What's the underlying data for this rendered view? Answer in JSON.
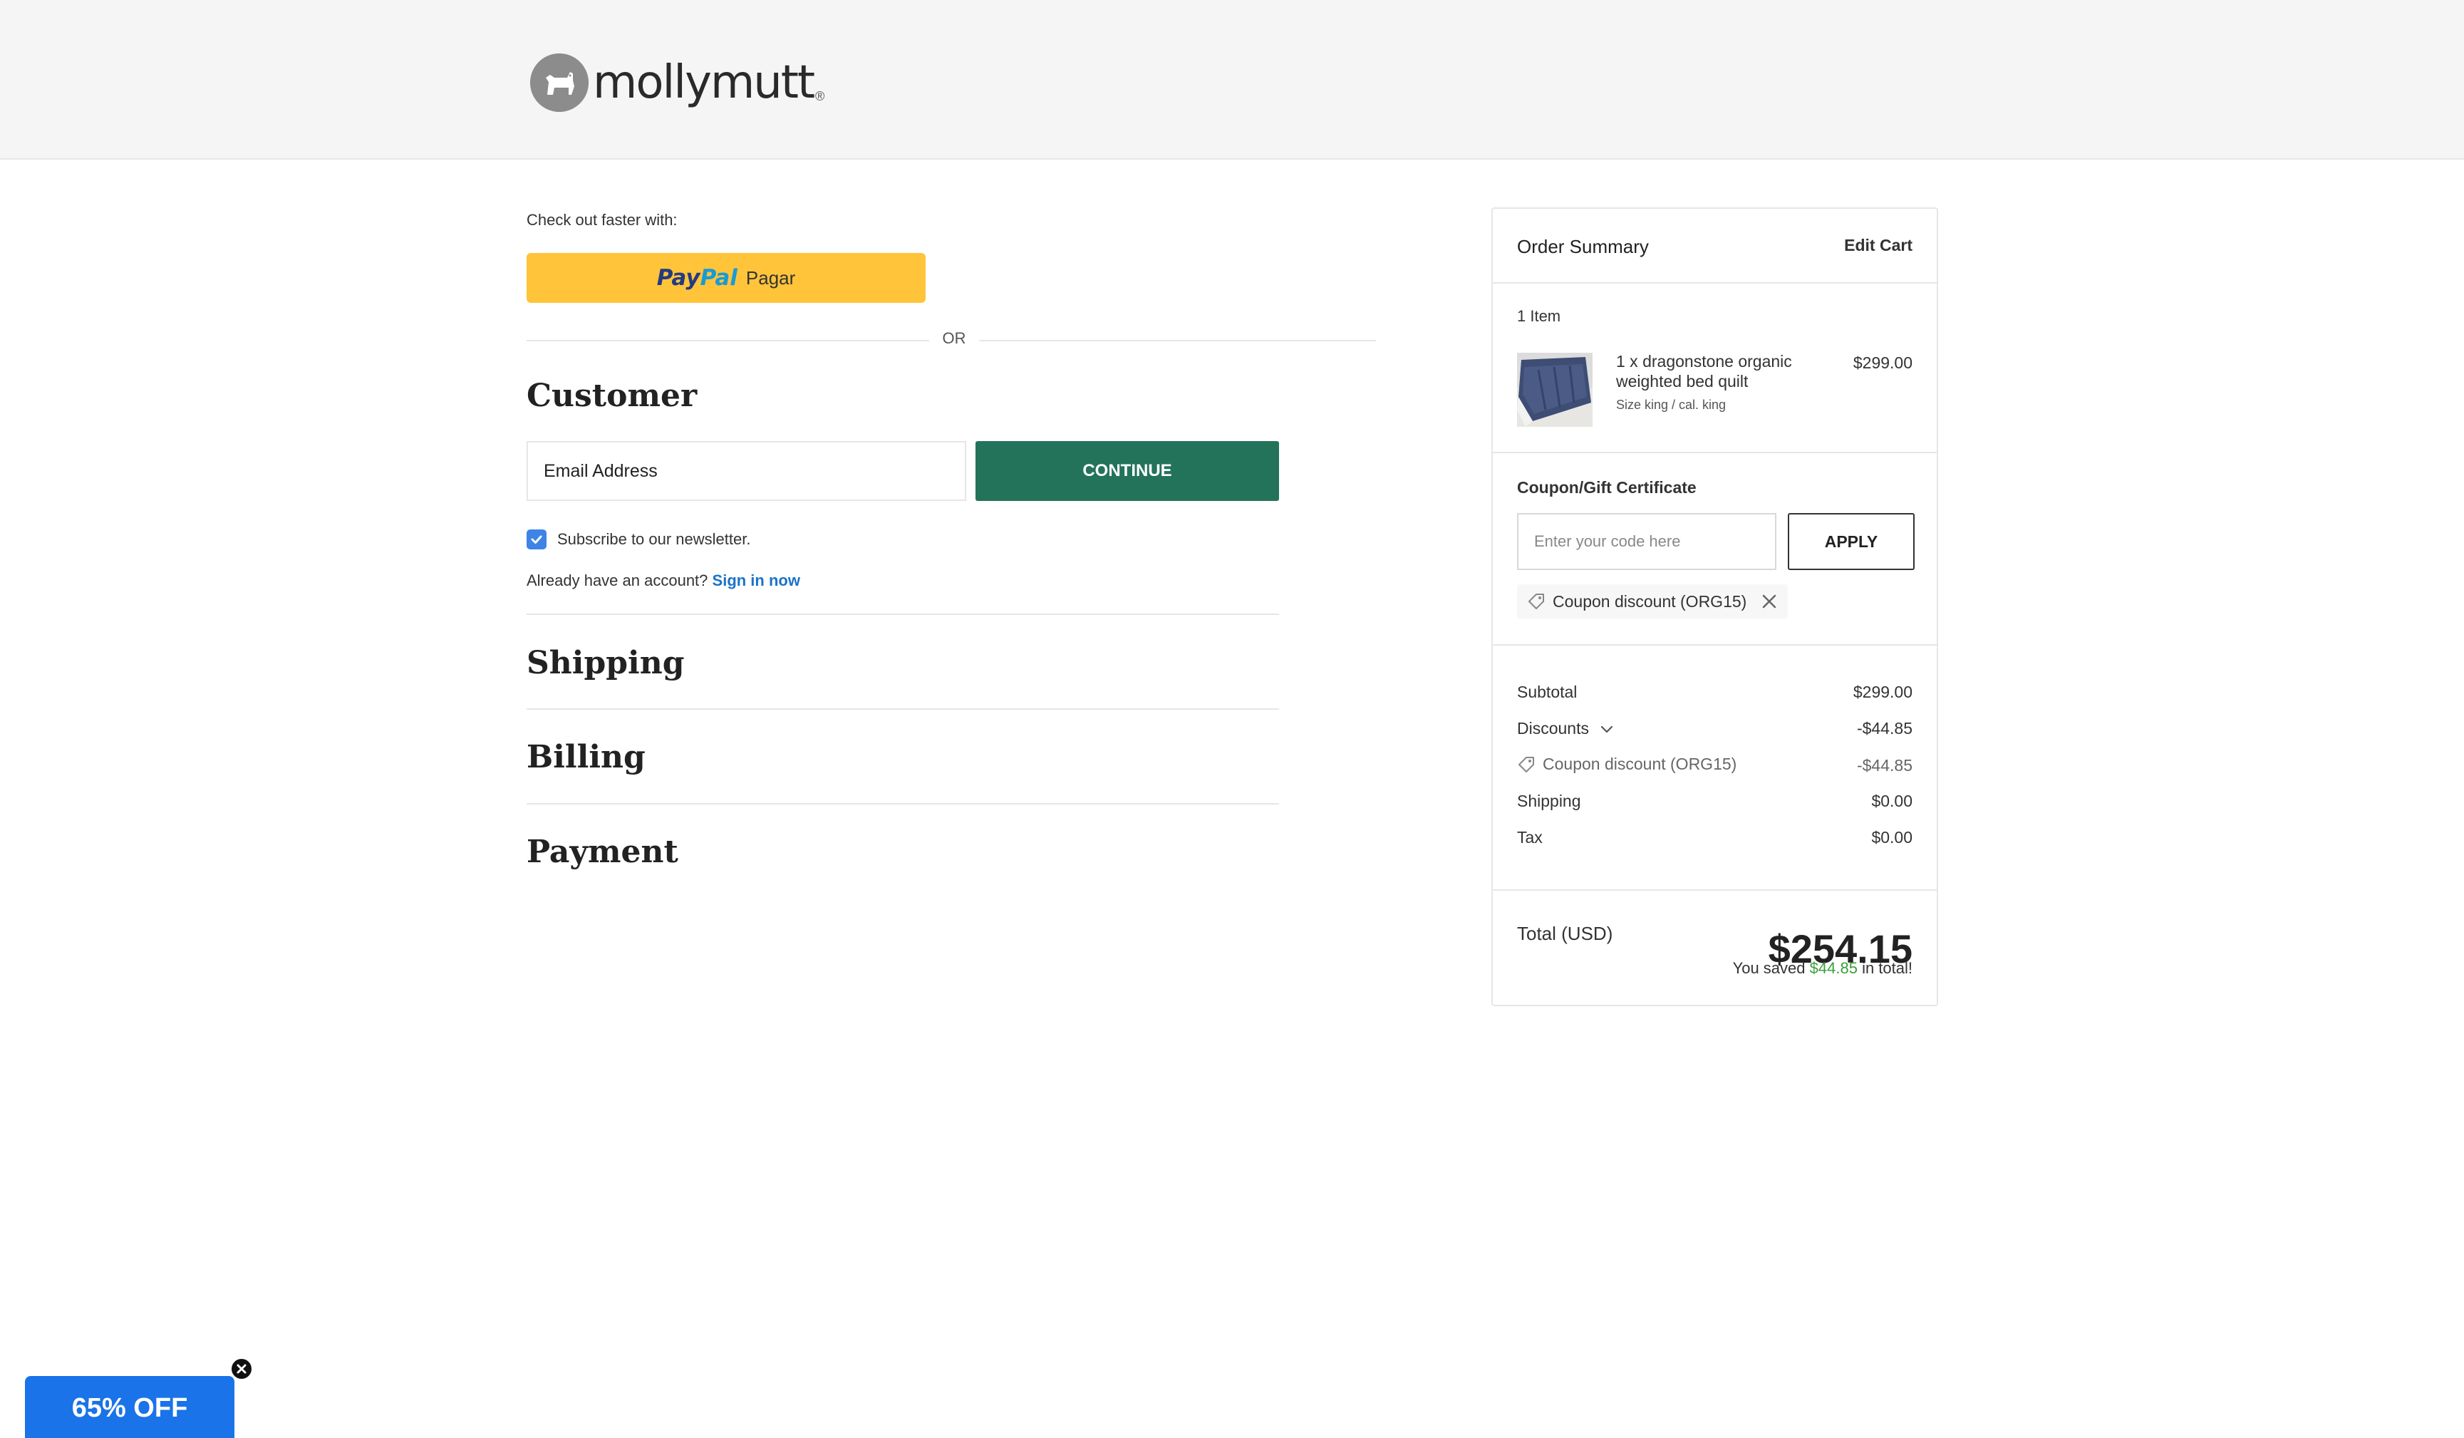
{
  "brand": {
    "name": "mollymutt",
    "reg_mark": "®"
  },
  "express_checkout": {
    "label": "Check out faster with:",
    "paypal": {
      "pay": "Pay",
      "pal": "Pal",
      "label": "Pagar"
    },
    "or_text": "OR"
  },
  "customer": {
    "title": "Customer",
    "email_placeholder": "Email Address",
    "continue_label": "CONTINUE",
    "newsletter_label": "Subscribe to our newsletter.",
    "newsletter_checked": true,
    "account_prompt": "Already have an account?",
    "sign_in_label": "Sign in now"
  },
  "steps": {
    "shipping": "Shipping",
    "billing": "Billing",
    "payment": "Payment"
  },
  "order_summary": {
    "title": "Order Summary",
    "edit_cart_label": "Edit Cart",
    "item_count": "1 Item",
    "items": [
      {
        "name_line1": "1 x dragonstone organic",
        "name_line2": "weighted bed quilt",
        "option": "Size king / cal. king",
        "price": "$299.00"
      }
    ],
    "coupon": {
      "heading": "Coupon/Gift Certificate",
      "placeholder": "Enter your code here",
      "apply_label": "APPLY",
      "applied": "Coupon discount (ORG15)"
    },
    "lines": {
      "subtotal_label": "Subtotal",
      "subtotal_value": "$299.00",
      "discounts_label": "Discounts",
      "discounts_value": "-$44.85",
      "coupon_label": "Coupon discount (ORG15)",
      "coupon_value": "-$44.85",
      "shipping_label": "Shipping",
      "shipping_value": "$0.00",
      "tax_label": "Tax",
      "tax_value": "$0.00"
    },
    "total": {
      "label": "Total (USD)",
      "amount": "$254.15",
      "saved_prefix": "You saved",
      "saved_amount": "$44.85",
      "saved_suffix": "in total!"
    }
  },
  "promo": {
    "label": "65% OFF"
  },
  "colors": {
    "accent_green": "#23735a",
    "link_blue": "#1a73c8",
    "paypal_yellow": "#ffc43a",
    "savings_green": "#3aa03a",
    "promo_blue": "#1a73e8",
    "checkbox_blue": "#3d84e6"
  }
}
